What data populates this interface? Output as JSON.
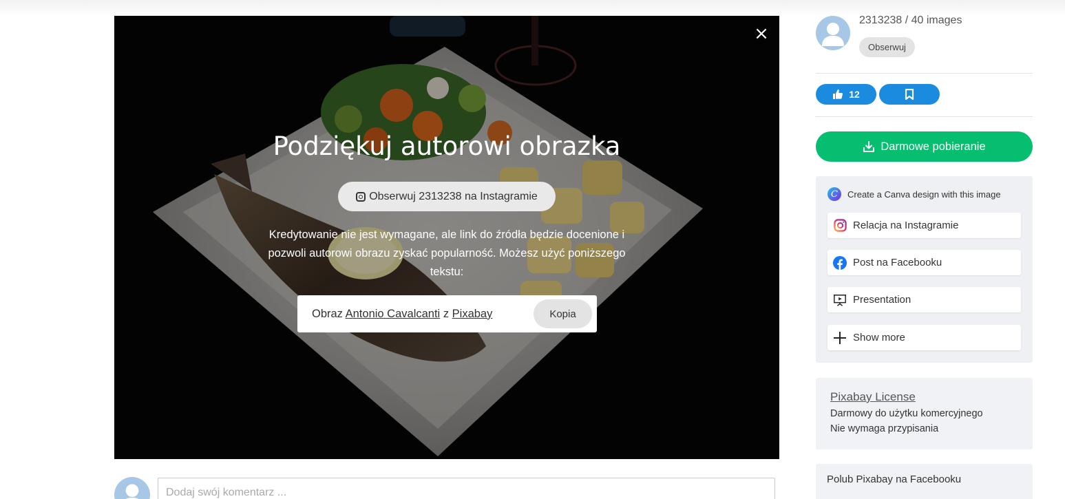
{
  "thanks_modal": {
    "title": "Podziękuj autorowi obrazka",
    "instagram_follow_label": "Obserwuj 2313238 na Instagramie",
    "credit_text": "Kredytowanie nie jest wymagane, ale link do źródła będzie docenione i pozwoli autorowi obrazu zyskać popularność. Możesz użyć poniższego tekstu:",
    "attribution": {
      "prefix": "Obraz",
      "author": "Antonio Cavalcanti",
      "connector": "z",
      "site": "Pixabay"
    },
    "copy_label": "Kopia",
    "close_glyph": "×"
  },
  "comment": {
    "placeholder": "Dodaj swój komentarz ..."
  },
  "author": {
    "name_line": "2313238 / 40 images",
    "follow_label": "Obserwuj"
  },
  "actions": {
    "likes": "12",
    "download_label": "Darmowe pobieranie"
  },
  "share": {
    "canva_label": "Create a Canva design with this image",
    "items": [
      {
        "label": "Relacja na Instagramie",
        "icon": "instagram-icon"
      },
      {
        "label": "Post na Facebooku",
        "icon": "facebook-icon"
      },
      {
        "label": "Presentation",
        "icon": "presentation-icon"
      },
      {
        "label": "Show more",
        "icon": "plus-icon"
      }
    ]
  },
  "license": {
    "link_label": "Pixabay License",
    "lines": [
      "Darmowy do użytku komercyjnego",
      "Nie wymaga przypisania"
    ]
  },
  "facebook_like": {
    "label": "Polub Pixabay na Facebooku"
  },
  "colors": {
    "download_green": "#05be6f",
    "like_blue": "#1b8be0",
    "panel_bg": "#eef0f3"
  }
}
